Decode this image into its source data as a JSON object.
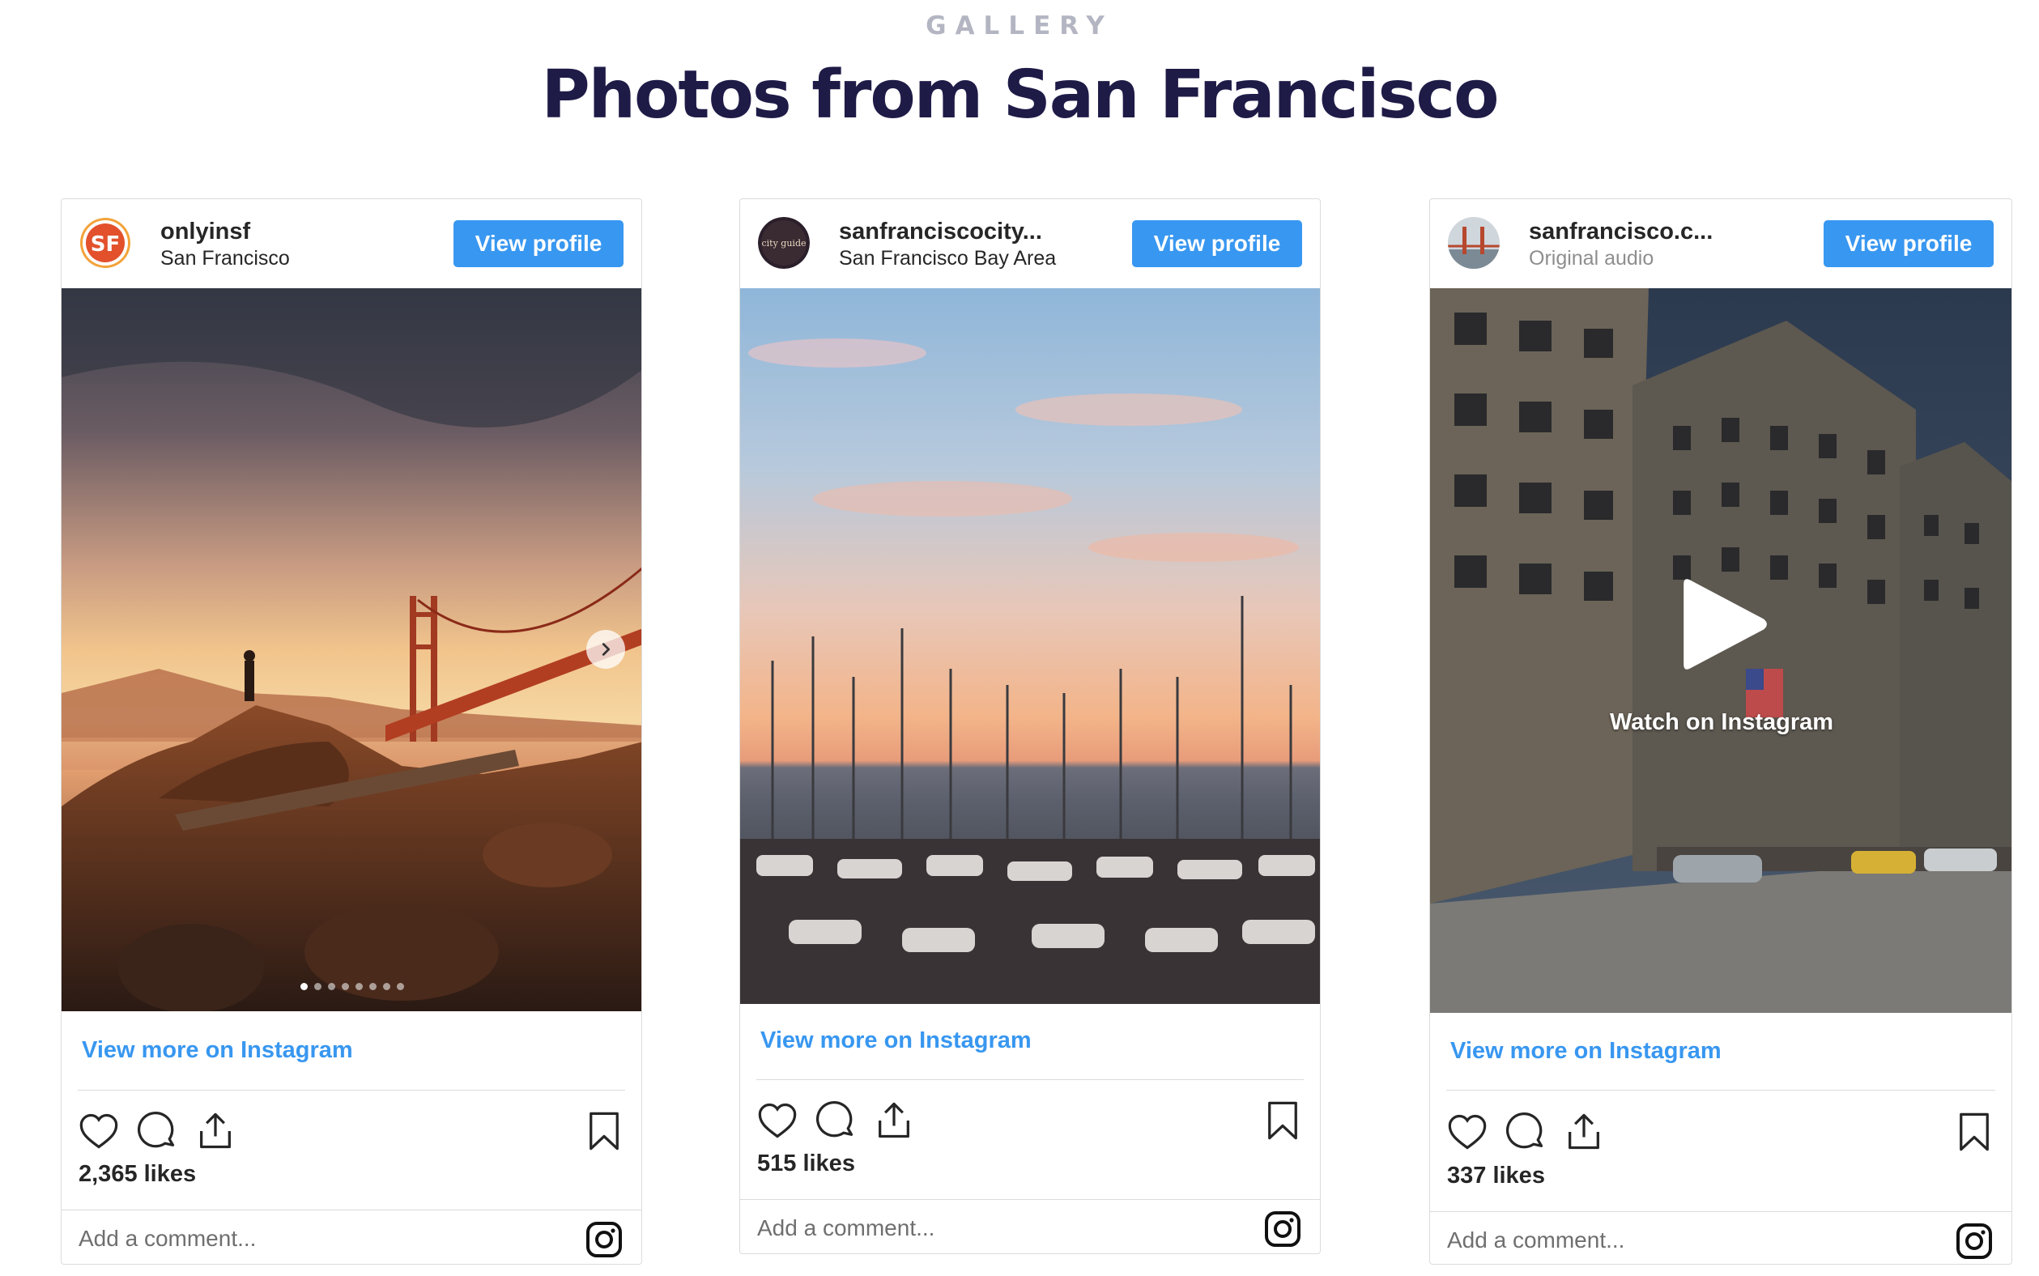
{
  "section": {
    "eyebrow": "GALLERY",
    "title": "Photos from San Francisco"
  },
  "posts": [
    {
      "username": "onlyinsf",
      "location": "San Francisco",
      "avatar_text": "SF",
      "view_profile_label": "View profile",
      "view_more_label": "View more on Instagram",
      "likes": "2,365 likes",
      "comment_placeholder": "Add a comment...",
      "media_type": "carousel",
      "carousel_slides": 8,
      "carousel_active": 1
    },
    {
      "username": "sanfranciscocity...",
      "location": "San Francisco Bay Area",
      "avatar_text": "city guide",
      "view_profile_label": "View profile",
      "view_more_label": "View more on Instagram",
      "likes": "515 likes",
      "comment_placeholder": "Add a comment...",
      "media_type": "image"
    },
    {
      "username": "sanfrancisco.c...",
      "location": "Original audio",
      "view_profile_label": "View profile",
      "view_more_label": "View more on Instagram",
      "watch_label": "Watch on Instagram",
      "likes": "337 likes",
      "comment_placeholder": "Add a comment...",
      "media_type": "video"
    }
  ],
  "colors": {
    "title": "#1e1b47",
    "eyebrow": "#b3b6c2",
    "link_blue": "#3897f0",
    "border": "#dbdbdb"
  },
  "icons": [
    "heart-icon",
    "comment-icon",
    "share-icon",
    "bookmark-icon",
    "instagram-icon",
    "chevron-right-icon",
    "play-icon"
  ]
}
